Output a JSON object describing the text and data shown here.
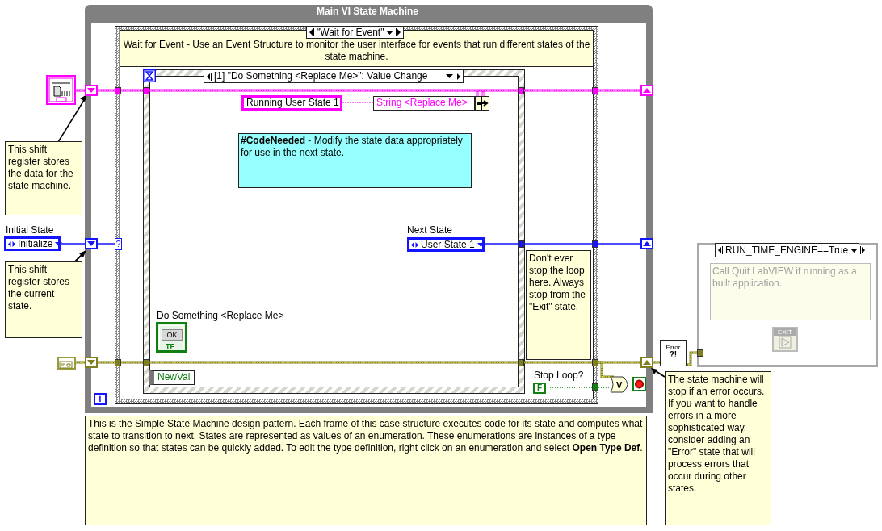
{
  "loop": {
    "title": "Main VI State Machine",
    "iteration_terminal": "i"
  },
  "case_structure": {
    "selector": "\"Wait for Event\"",
    "comment": "Wait for Event - Use an Event Structure to monitor the user interface for events that run different states of the state machine."
  },
  "event_structure": {
    "selector": "[1] \"Do Something <Replace Me>\": Value Change",
    "event_data": "NewVal"
  },
  "state_data": {
    "constant": "Running User State 1",
    "element": "String <Replace Me>"
  },
  "code_note": "**#CodeNeeded** - Modify the state data appropriately for use in the next state.",
  "button": {
    "label": "Do Something <Replace Me>",
    "text": "OK",
    "type": "TF"
  },
  "next_state": {
    "label": "Next State",
    "value": "User State 1"
  },
  "initial_state": {
    "label": "Initial State",
    "value": "Initialize",
    "tunnel": "?"
  },
  "data_note": "This shift register stores the data for the state machine.",
  "state_note": "This shift register stores the current state.",
  "stop_note": "Don't ever stop the loop here. Always stop from the \"Exit\" state.",
  "stop": {
    "label": "Stop Loop?",
    "constant": "F",
    "gate": "V"
  },
  "error_handler": {
    "line1": "Error",
    "line2": "?!"
  },
  "error_note": "The state machine will stop if an error occurs. If you want to handle errors in a more sophisticated way, consider adding an \"Error\" state that will process errors that occur during other states.",
  "quit_case": {
    "selector": "RUN_TIME_ENGINE==True",
    "comment": "Call Quit LabVIEW if running as a built application.",
    "icon_text": "EXIT"
  },
  "description": "This is the Simple State Machine design pattern. Each frame of this case structure executes code for its state and computes what state to transition to next. States are represented as values of an enumeration. These enumerations are instances of a type definition so that states can be quickly added. To edit the type definition, right click on an enumeration and select **Open Type Def**."
}
